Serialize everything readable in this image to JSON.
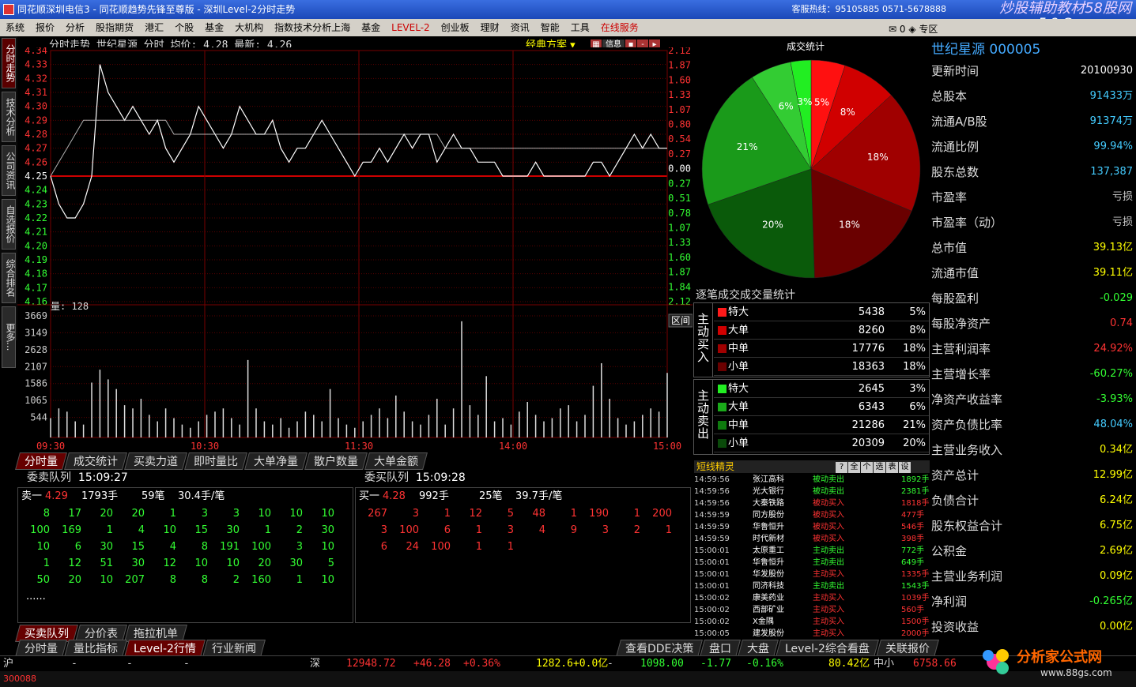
{
  "window": {
    "title": "同花顺深圳电信3 - 同花顺趋势先锋至尊版 - 深圳Level-2分时走势",
    "hotline": "客服热线：95105885 0571-5678888"
  },
  "watermark": {
    "line1": "炒股辅助教材58股网",
    "line2": "w w w . 5 8 G u . c o m",
    "bottom1": "分析家公式网",
    "bottom2": "www.88gs.com"
  },
  "menu": [
    "系统",
    "报价",
    "分析",
    "股指期货",
    "港汇",
    "个股",
    "基金",
    "大机构",
    "指数技术分析上海",
    "基金",
    "LEVEL-2",
    "创业板",
    "理财",
    "资讯",
    "智能",
    "工具",
    "在线服务"
  ],
  "mail": {
    "count": "0",
    "label": "专区"
  },
  "left_tabs": [
    "分时走势",
    "技术分析",
    "公司资讯",
    "自选报价",
    "综合排名",
    "更多..."
  ],
  "chart": {
    "header": "分时走势  世纪星源 分时 均价: 4.28 最新: 4.26",
    "scheme": "经典方案",
    "info_btn": "信息",
    "price_ticks": [
      "4.34",
      "4.33",
      "4.32",
      "4.31",
      "4.30",
      "4.29",
      "4.28",
      "4.27",
      "4.26",
      "4.25",
      "4.24",
      "4.23",
      "4.22",
      "4.21",
      "4.20",
      "4.19",
      "4.18",
      "4.17",
      "4.16"
    ],
    "pct_ticks": [
      "2.12",
      "1.87",
      "1.60",
      "1.33",
      "1.07",
      "0.80",
      "0.54",
      "0.27",
      "0.00",
      "0.27",
      "0.51",
      "0.78",
      "1.07",
      "1.33",
      "1.60",
      "1.87",
      "1.84",
      "2.12"
    ],
    "prev_close": 4.25,
    "vol_label": "量: 128",
    "vol_ticks": [
      "3669",
      "3149",
      "2628",
      "2107",
      "1586",
      "1065",
      "544"
    ],
    "time_ticks": [
      "09:30",
      "10:30",
      "11:30",
      "14:00",
      "15:00"
    ],
    "interval_btn": "区间",
    "chart_data": {
      "type": "line",
      "title": "分时走势",
      "series": [
        {
          "name": "price",
          "values": [
            4.25,
            4.23,
            4.22,
            4.22,
            4.23,
            4.25,
            4.33,
            4.31,
            4.3,
            4.29,
            4.3,
            4.29,
            4.28,
            4.29,
            4.27,
            4.26,
            4.27,
            4.28,
            4.3,
            4.29,
            4.28,
            4.27,
            4.28,
            4.3,
            4.29,
            4.28,
            4.28,
            4.29,
            4.27,
            4.26,
            4.27,
            4.27,
            4.28,
            4.29,
            4.28,
            4.27,
            4.26,
            4.25,
            4.26,
            4.26,
            4.27,
            4.26,
            4.27,
            4.28,
            4.27,
            4.28,
            4.28,
            4.26,
            4.27,
            4.28,
            4.27,
            4.27,
            4.26,
            4.26,
            4.26,
            4.25,
            4.25,
            4.25,
            4.25,
            4.26,
            4.25,
            4.25,
            4.25,
            4.25,
            4.25,
            4.25,
            4.26,
            4.26,
            4.25,
            4.26,
            4.27,
            4.28,
            4.27,
            4.28,
            4.27,
            4.27
          ]
        },
        {
          "name": "avg",
          "values": [
            4.25,
            4.26,
            4.27,
            4.28,
            4.29,
            4.29,
            4.29,
            4.29,
            4.29,
            4.29,
            4.29,
            4.29,
            4.29,
            4.29,
            4.29,
            4.28,
            4.28,
            4.28,
            4.28,
            4.28,
            4.28,
            4.28,
            4.28,
            4.28,
            4.28,
            4.28,
            4.28,
            4.28,
            4.28,
            4.28,
            4.28,
            4.28,
            4.28,
            4.28,
            4.28,
            4.28,
            4.28,
            4.28,
            4.28,
            4.28,
            4.28,
            4.28,
            4.28,
            4.28,
            4.28,
            4.28,
            4.28,
            4.28,
            4.27,
            4.27,
            4.27,
            4.27,
            4.27,
            4.27,
            4.27,
            4.27,
            4.27,
            4.27,
            4.27,
            4.27,
            4.27,
            4.27,
            4.27,
            4.27,
            4.27,
            4.27,
            4.27,
            4.27,
            4.27,
            4.27,
            4.27,
            4.27,
            4.27,
            4.27,
            4.27,
            4.27
          ]
        }
      ],
      "ylim": [
        4.16,
        4.34
      ],
      "volume": [
        600,
        900,
        800,
        500,
        400,
        1700,
        2100,
        1800,
        1500,
        1000,
        900,
        1200,
        700,
        500,
        900,
        600,
        400,
        300,
        500,
        700,
        800,
        900,
        600,
        400,
        2400,
        900,
        500,
        400,
        600,
        300,
        500,
        800,
        700,
        500,
        1500,
        600,
        400,
        300,
        500,
        700,
        900,
        600,
        1300,
        800,
        500,
        400,
        700,
        1200,
        400,
        900,
        3600,
        1000,
        700,
        1900,
        500,
        600,
        400,
        800,
        1100,
        700,
        500,
        600,
        900,
        1000,
        500,
        700,
        1600,
        2300,
        1200,
        600,
        400,
        500,
        700,
        900,
        800,
        2000
      ]
    }
  },
  "bottom_tabs": [
    "分时量",
    "成交统计",
    "买卖力道",
    "即时量比",
    "大单净量",
    "散户数量",
    "大单金额"
  ],
  "sell_queue": {
    "label": "委卖队列",
    "time": "15:09:27",
    "head": {
      "name": "卖一",
      "price": "4.29",
      "vol": "1793手",
      "count": "59笔",
      "avg": "30.4手/笔"
    },
    "rows": [
      [
        "8",
        "17",
        "20",
        "20",
        "1",
        "3",
        "3",
        "10",
        "10",
        "10"
      ],
      [
        "100",
        "169",
        "1",
        "4",
        "10",
        "15",
        "30",
        "1",
        "2",
        "30"
      ],
      [
        "10",
        "6",
        "30",
        "15",
        "4",
        "8",
        "191",
        "100",
        "3",
        "10"
      ],
      [
        "1",
        "12",
        "51",
        "30",
        "12",
        "10",
        "10",
        "20",
        "30",
        "5"
      ],
      [
        "50",
        "20",
        "10",
        "207",
        "8",
        "8",
        "2",
        "160",
        "1",
        "10"
      ]
    ],
    "more": "......"
  },
  "buy_queue": {
    "label": "委买队列",
    "time": "15:09:28",
    "head": {
      "name": "买一",
      "price": "4.28",
      "vol": "992手",
      "count": "25笔",
      "avg": "39.7手/笔"
    },
    "rows": [
      [
        "267",
        "3",
        "1",
        "12",
        "5",
        "48",
        "1",
        "190",
        "1",
        "200"
      ],
      [
        "3",
        "100",
        "6",
        "1",
        "3",
        "4",
        "9",
        "3",
        "2",
        "1"
      ],
      [
        "6",
        "24",
        "100",
        "1",
        "1",
        "",
        "",
        "",
        "",
        ""
      ]
    ]
  },
  "stock_name": "世纪星源 000005",
  "pie": {
    "title": "成交统计",
    "chart_data": {
      "type": "pie",
      "labels": [
        "5%",
        "8%",
        "18%",
        "18%",
        "20%",
        "21%",
        "6%",
        "3%"
      ],
      "values": [
        5,
        8,
        18,
        18,
        20,
        21,
        6,
        3
      ],
      "colors": [
        "#ff1010",
        "#d00000",
        "#a00000",
        "#6a0000",
        "#0a5a0a",
        "#1a9a1a",
        "#33cc33",
        "#22ee22"
      ]
    }
  },
  "flow": {
    "title": "逐笔成交成交量统计",
    "buy_side": "主动买入",
    "sell_side": "主动卖出",
    "buy": [
      {
        "label": "特大",
        "value": "5438",
        "pct": "5%",
        "color": "#ff1a1a"
      },
      {
        "label": "大单",
        "value": "8260",
        "pct": "8%",
        "color": "#d00000"
      },
      {
        "label": "中单",
        "value": "17776",
        "pct": "18%",
        "color": "#a00000"
      },
      {
        "label": "小单",
        "value": "18363",
        "pct": "18%",
        "color": "#6a0000"
      }
    ],
    "sell": [
      {
        "label": "特大",
        "value": "2645",
        "pct": "3%",
        "color": "#22ee22"
      },
      {
        "label": "大单",
        "value": "6343",
        "pct": "6%",
        "color": "#1aaa1a"
      },
      {
        "label": "中单",
        "value": "21286",
        "pct": "21%",
        "color": "#0e7a0e"
      },
      {
        "label": "小单",
        "value": "20309",
        "pct": "20%",
        "color": "#0a4a0a"
      }
    ]
  },
  "tape": {
    "title": "短线精灵",
    "btns": [
      "?",
      "全",
      "个",
      "选",
      "表",
      "设"
    ],
    "rows": [
      [
        "14:59:56",
        "张江高科",
        "被动卖出",
        "1892手"
      ],
      [
        "14:59:56",
        "光大银行",
        "被动卖出",
        "2381手"
      ],
      [
        "14:59:56",
        "大秦铁路",
        "被动买入",
        "1818手"
      ],
      [
        "14:59:59",
        "同方股份",
        "被动买入",
        "477手"
      ],
      [
        "14:59:59",
        "华鲁恒升",
        "被动买入",
        "546手"
      ],
      [
        "14:59:59",
        "时代新材",
        "被动买入",
        "398手"
      ],
      [
        "15:00:01",
        "太原重工",
        "主动卖出",
        "772手"
      ],
      [
        "15:00:01",
        "华鲁恒升",
        "主动卖出",
        "649手"
      ],
      [
        "15:00:01",
        "华发股份",
        "主动买入",
        "1335手"
      ],
      [
        "15:00:01",
        "同济科技",
        "主动卖出",
        "1543手"
      ],
      [
        "15:00:02",
        "康美药业",
        "主动买入",
        "1039手"
      ],
      [
        "15:00:02",
        "西部矿业",
        "主动买入",
        "560手"
      ],
      [
        "15:00:02",
        "X金隅",
        "主动买入",
        "1500手"
      ],
      [
        "15:00:05",
        "建发股份",
        "主动买入",
        "2000手"
      ]
    ]
  },
  "fundamentals": [
    {
      "k": "更新时间",
      "v": "20100930",
      "c": "#fff"
    },
    {
      "k": "总股本",
      "v": "91433万",
      "c": "#4cf"
    },
    {
      "k": "流通A/B股",
      "v": "91374万",
      "c": "#4cf"
    },
    {
      "k": "流通比例",
      "v": "99.94%",
      "c": "#4cf"
    },
    {
      "k": "股东总数",
      "v": "137,387",
      "c": "#4cf"
    },
    {
      "k": "市盈率",
      "v": "亏损",
      "c": "#ccc"
    },
    {
      "k": "市盈率（动）",
      "v": "亏损",
      "c": "#ccc"
    },
    {
      "k": "总市值",
      "v": "39.13亿",
      "c": "#ff0"
    },
    {
      "k": "流通市值",
      "v": "39.11亿",
      "c": "#ff0"
    },
    {
      "k": "每股盈利",
      "v": "-0.029",
      "c": "#3f3"
    },
    {
      "k": "每股净资产",
      "v": "0.74",
      "c": "#f33"
    },
    {
      "k": "主营利润率",
      "v": "24.92%",
      "c": "#f33"
    },
    {
      "k": "主营增长率",
      "v": "-60.27%",
      "c": "#3f3"
    },
    {
      "k": "净资产收益率",
      "v": "-3.93%",
      "c": "#3f3"
    },
    {
      "k": "资产负债比率",
      "v": "48.04%",
      "c": "#4cf"
    },
    {
      "k": "主营业务收入",
      "v": "0.34亿",
      "c": "#ff0"
    },
    {
      "k": "资产总计",
      "v": "12.99亿",
      "c": "#ff0"
    },
    {
      "k": "负债合计",
      "v": "6.24亿",
      "c": "#ff0"
    },
    {
      "k": "股东权益合计",
      "v": "6.75亿",
      "c": "#ff0"
    },
    {
      "k": "公积金",
      "v": "2.69亿",
      "c": "#ff0"
    },
    {
      "k": "主营业务利润",
      "v": "0.09亿",
      "c": "#ff0"
    },
    {
      "k": "净利润",
      "v": "-0.265亿",
      "c": "#3f3"
    },
    {
      "k": "投资收益",
      "v": "0.00亿",
      "c": "#ff0"
    }
  ],
  "status_tabs1": [
    "买卖队列",
    "分价表",
    "拖拉机单"
  ],
  "status_tabs2": [
    "分时量",
    "量比指标",
    "Level-2行情",
    "行业新闻"
  ],
  "status_tabs3": [
    "查看DDE决策",
    "盘口",
    "大盘",
    "Level-2综合看盘",
    "关联报价"
  ],
  "index_bar": {
    "sh_label": "沪",
    "sh_vals": "-",
    "sz_label": "深",
    "sz_index": "12948.72",
    "sz_chg": "+46.28",
    "sz_pct": "+0.36%",
    "sz_amt": "1282.6+0.0亿",
    "sm_idx": "1098.00",
    "sm_chg": "-1.77",
    "sm_pct": "-0.16%",
    "sm_amt": "80.42亿",
    "zx_label": "中小",
    "zx_idx": "6758.66"
  },
  "foot": {
    "code": "300088"
  }
}
